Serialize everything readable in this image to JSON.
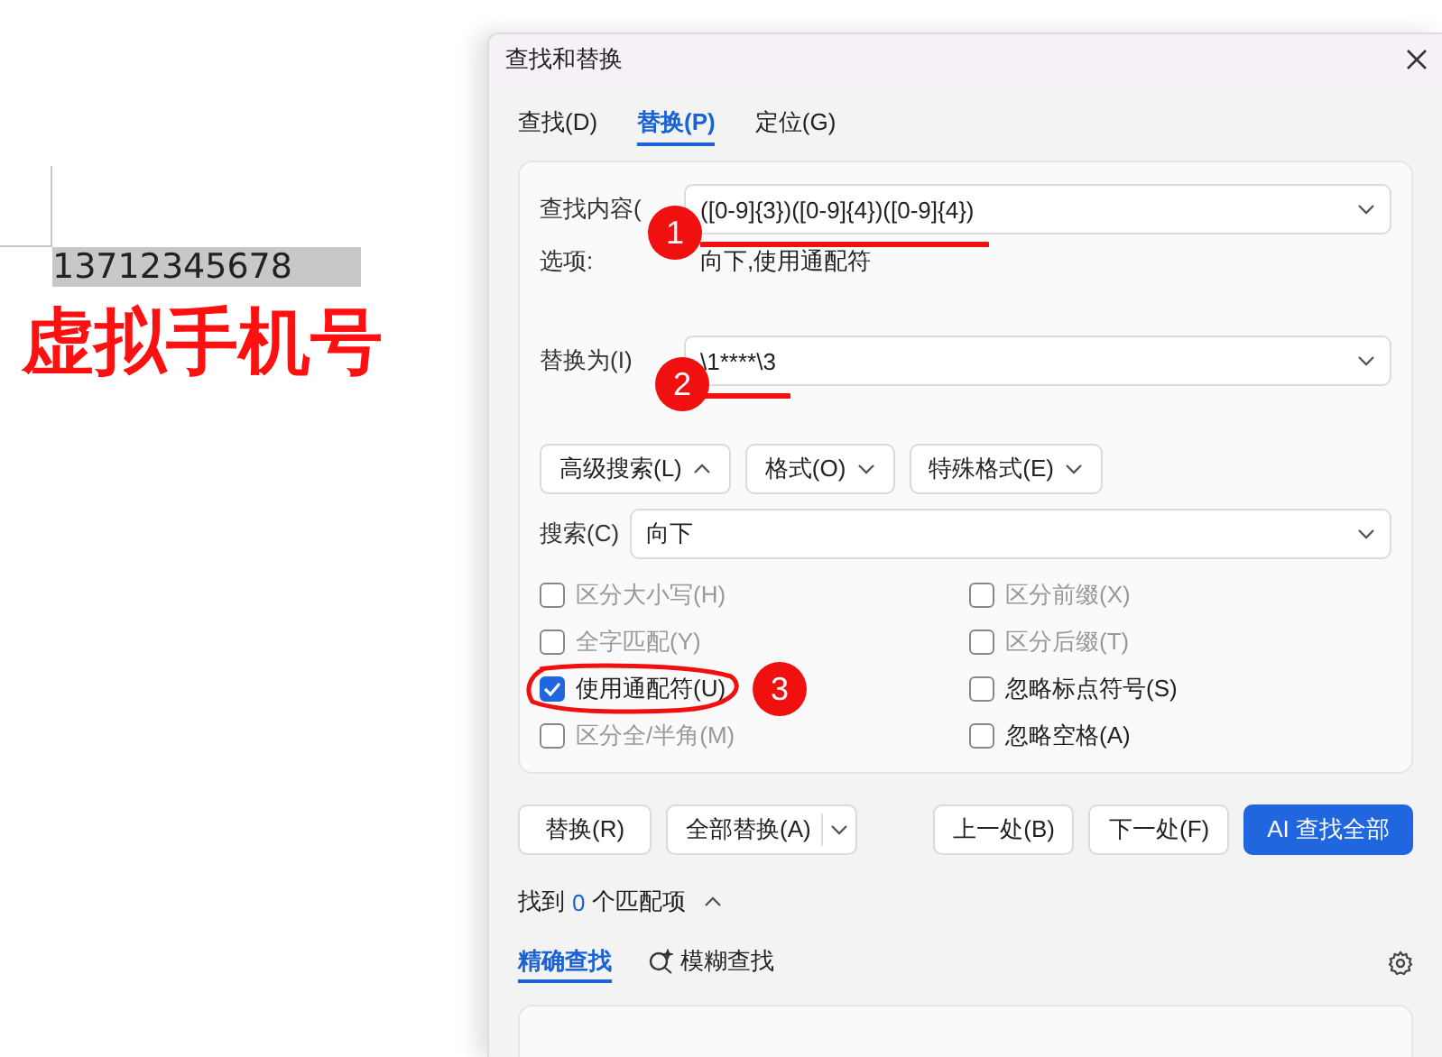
{
  "document": {
    "text": "13712345678",
    "overlay_label": "虚拟手机号"
  },
  "dialog": {
    "title": "查找和替换",
    "tabs": [
      {
        "label": "查找(D)",
        "selected": false
      },
      {
        "label": "替换(P)",
        "selected": true
      },
      {
        "label": "定位(G)",
        "selected": false
      }
    ],
    "find": {
      "label": "查找内容(",
      "value": "([0-9]{3})([0-9]{4})([0-9]{4})",
      "badge": "1"
    },
    "options": {
      "label": "选项:",
      "value": "向下,使用通配符"
    },
    "replace": {
      "label": "替换为(I)",
      "value": "\\1****\\3",
      "badge": "2"
    },
    "menu_buttons": [
      {
        "label": "高级搜索(L)",
        "expanded": true
      },
      {
        "label": "格式(O)",
        "expanded": false
      },
      {
        "label": "特殊格式(E)",
        "expanded": false
      }
    ],
    "search": {
      "label": "搜索(C)",
      "value": "向下"
    },
    "checkboxes": [
      {
        "label": "区分大小写(H)",
        "checked": false,
        "disabled": true
      },
      {
        "label": "区分前缀(X)",
        "checked": false,
        "disabled": true
      },
      {
        "label": "全字匹配(Y)",
        "checked": false,
        "disabled": true
      },
      {
        "label": "区分后缀(T)",
        "checked": false,
        "disabled": true
      },
      {
        "label": "使用通配符(U)",
        "checked": true,
        "disabled": false,
        "badge": "3"
      },
      {
        "label": "忽略标点符号(S)",
        "checked": false,
        "disabled": false
      },
      {
        "label": "区分全/半角(M)",
        "checked": false,
        "disabled": true
      },
      {
        "label": "忽略空格(A)",
        "checked": false,
        "disabled": false
      }
    ],
    "actions_left": [
      {
        "label": "替换(R)",
        "kind": "button"
      },
      {
        "label": "全部替换(A)",
        "kind": "split"
      }
    ],
    "actions_right": [
      {
        "label": "上一处(B)",
        "kind": "button"
      },
      {
        "label": "下一处(F)",
        "kind": "button"
      },
      {
        "label": "AI 查找全部",
        "kind": "primary"
      }
    ],
    "result": {
      "prefix": "找到",
      "count": "0",
      "suffix": "个匹配项",
      "expanded": true
    },
    "result_tabs": [
      {
        "label": "精确查找",
        "selected": true,
        "kind": "plain"
      },
      {
        "label": "模糊查找",
        "selected": false,
        "kind": "fuzzy"
      }
    ]
  }
}
